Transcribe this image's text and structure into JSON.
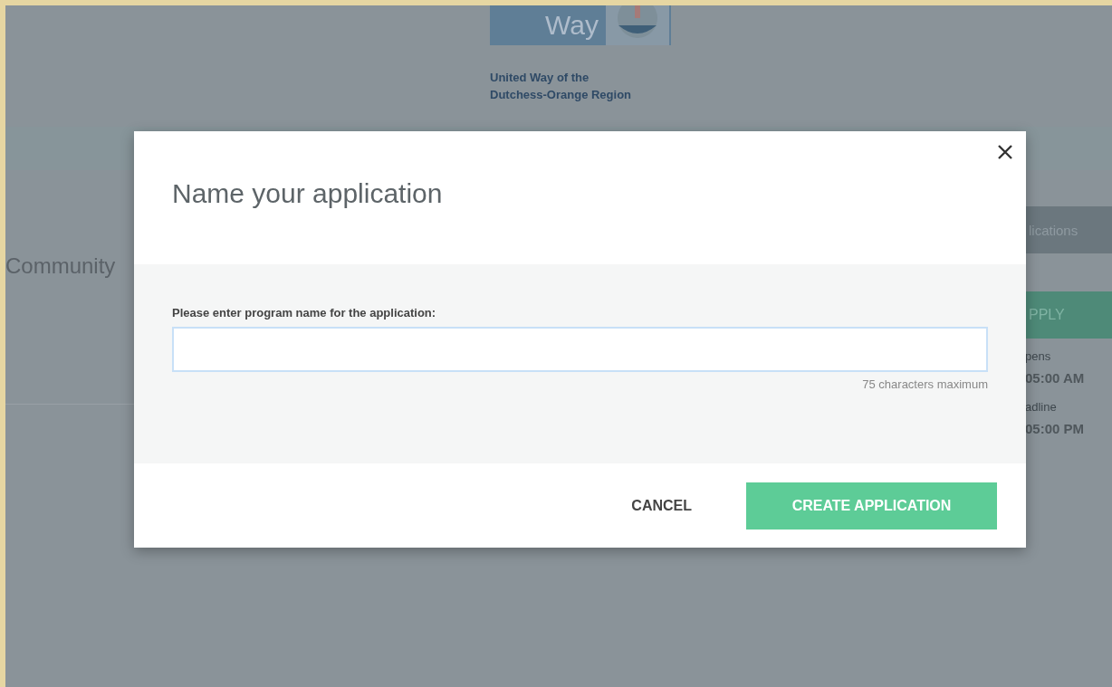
{
  "background_page": {
    "logo_word": "Way",
    "org_name": [
      "United Way of the",
      "Dutchess-Orange Region"
    ],
    "heading": "Community",
    "side_button": "lications",
    "apply_button": "PPLY",
    "details": [
      {
        "label": "pens",
        "value": "05:00 AM"
      },
      {
        "label": "adline",
        "value": "05:00 PM"
      }
    ]
  },
  "dialog": {
    "title": "Name your application",
    "field_label": "Please enter program name for the application:",
    "field_hint": "75 characters maximum",
    "buttons": [
      {
        "kind": "text",
        "label": "CANCEL"
      },
      {
        "kind": "primary",
        "label": "CREATE APPLICATION"
      }
    ]
  }
}
